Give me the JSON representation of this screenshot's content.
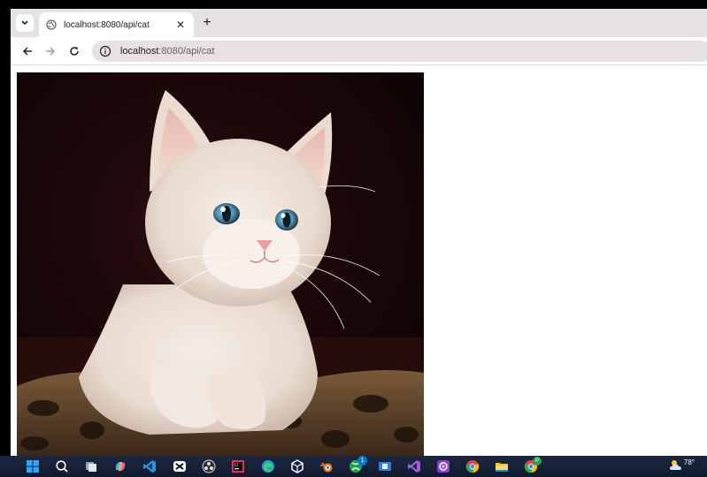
{
  "browser": {
    "tab": {
      "title": "localhost:8080/api/cat"
    },
    "address": {
      "host": "localhost",
      "rest": ":8080/api/cat"
    }
  },
  "page": {
    "image_alt": "cat image"
  },
  "taskbar": {
    "icons": [
      "windows-start-icon",
      "search-icon",
      "task-view-icon",
      "copilot-icon",
      "vscode-icon",
      "capcut-icon",
      "obs-icon",
      "intellij-icon",
      "edge-icon",
      "unity-icon",
      "blender-icon",
      "xbox-icon",
      "app-window-icon",
      "visual-studio-icon",
      "obs-purple-icon",
      "chrome-icon",
      "file-explorer-icon",
      "chrome-profile-icon"
    ],
    "xbox_badge": "1",
    "chrome_profile_badge": "P",
    "weather_temp": "78°"
  },
  "colors": {
    "tabstrip": "#e8e1e1",
    "omnibox": "#e8e1e1",
    "taskbar": "#1c2740",
    "accent_blue": "#0078d4"
  }
}
